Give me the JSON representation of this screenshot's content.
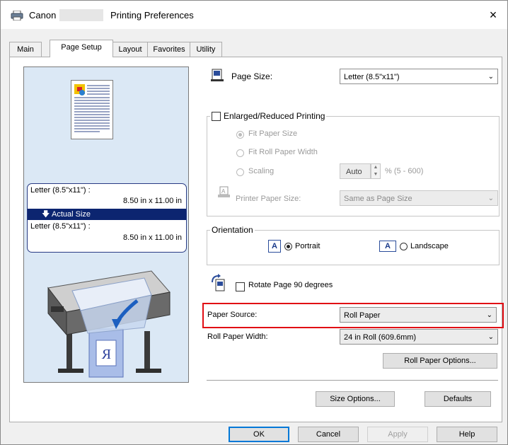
{
  "window": {
    "title_left": "Canon",
    "title_right": "Printing Preferences",
    "close_label": "×"
  },
  "tabs": [
    {
      "label": "Main"
    },
    {
      "label": "Page Setup"
    },
    {
      "label": "Layout"
    },
    {
      "label": "Favorites"
    },
    {
      "label": "Utility"
    }
  ],
  "preview": {
    "line1": "Letter (8.5\"x11\") :",
    "line2": "8.50 in x 11.00 in",
    "actual_size": "Actual Size",
    "line3": "Letter (8.5\"x11\") :",
    "line4": "8.50 in x 11.00 in",
    "printer_label": "R"
  },
  "page_size": {
    "label": "Page Size:",
    "value": "Letter (8.5\"x11\")"
  },
  "enlarged": {
    "label": "Enlarged/Reduced Printing",
    "fit_paper": "Fit Paper Size",
    "fit_roll": "Fit Roll Paper Width",
    "scaling": "Scaling",
    "scaling_value": "Auto",
    "scaling_range": "% (5 - 600)",
    "printer_paper_label": "Printer Paper Size:",
    "printer_paper_value": "Same as Page Size"
  },
  "orientation": {
    "title": "Orientation",
    "portrait": "Portrait",
    "landscape": "Landscape"
  },
  "rotate": {
    "label": "Rotate Page 90 degrees"
  },
  "paper_source": {
    "label": "Paper Source:",
    "value": "Roll Paper"
  },
  "roll_width": {
    "label": "Roll Paper Width:",
    "value": "24 in Roll (609.6mm)"
  },
  "buttons": {
    "roll_options": "Roll Paper Options...",
    "size_options": "Size Options...",
    "defaults": "Defaults",
    "ok": "OK",
    "cancel": "Cancel",
    "apply": "Apply",
    "help": "Help"
  },
  "colors": {
    "highlight": "#e10d14",
    "actual_bar": "#0c2570",
    "preview_bg": "#dbe8f5"
  }
}
